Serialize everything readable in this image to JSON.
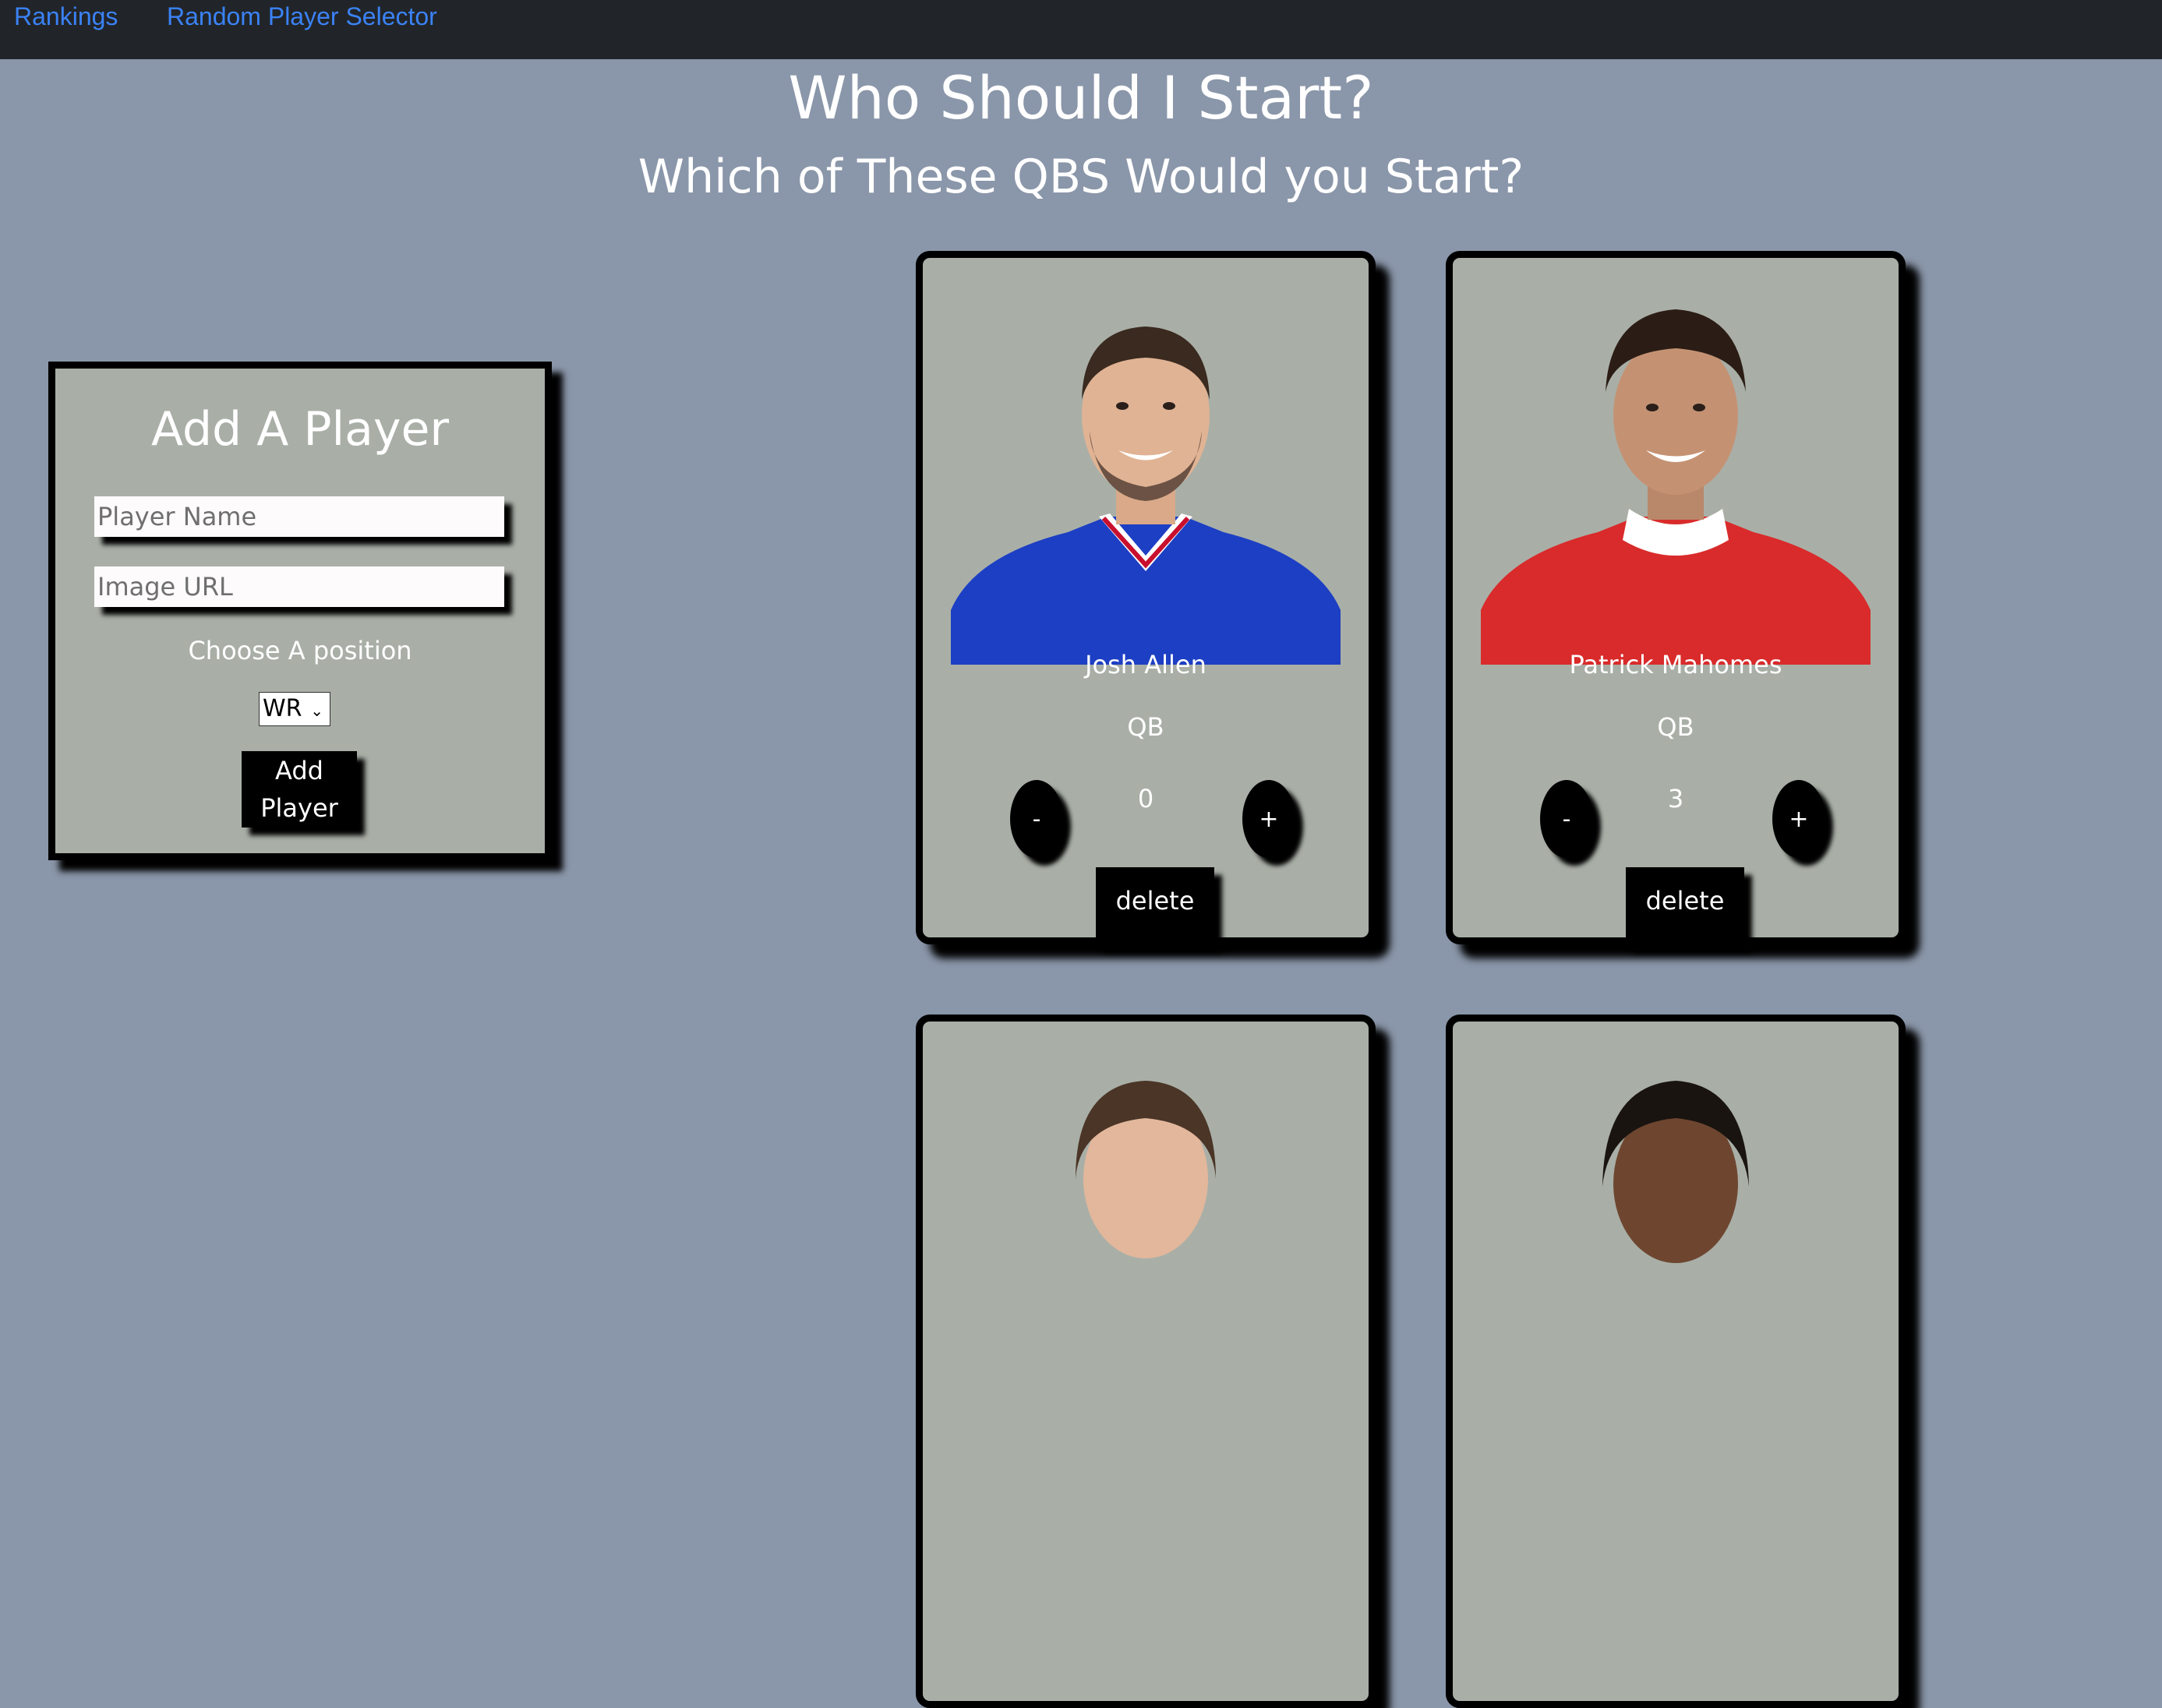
{
  "nav": {
    "links": [
      "Rankings",
      "Random Player Selector"
    ]
  },
  "header": {
    "title": "Who Should I Start?",
    "subtitle": "Which of These QBS Would you Start?"
  },
  "add_player": {
    "title": "Add A Player",
    "name_placeholder": "Player Name",
    "image_placeholder": "Image URL",
    "position_label": "Choose A position",
    "position_selected": "WR",
    "button_label": "Add Player"
  },
  "cards": [
    {
      "name": "Josh Allen",
      "position": "QB",
      "count": "0",
      "minus": "-",
      "plus": "+",
      "delete": "delete",
      "jersey_color": "#1d3fc4",
      "jersey_trim": "#c8102e"
    },
    {
      "name": "Patrick Mahomes",
      "position": "QB",
      "count": "3",
      "minus": "-",
      "plus": "+",
      "delete": "delete",
      "jersey_color": "#d92b2b",
      "jersey_trim": "#ffffff"
    }
  ],
  "colors": {
    "page_bg": "#8a96a9",
    "navbar_bg": "#212529",
    "link": "#3b82f6",
    "card_bg": "#a9afa7"
  }
}
